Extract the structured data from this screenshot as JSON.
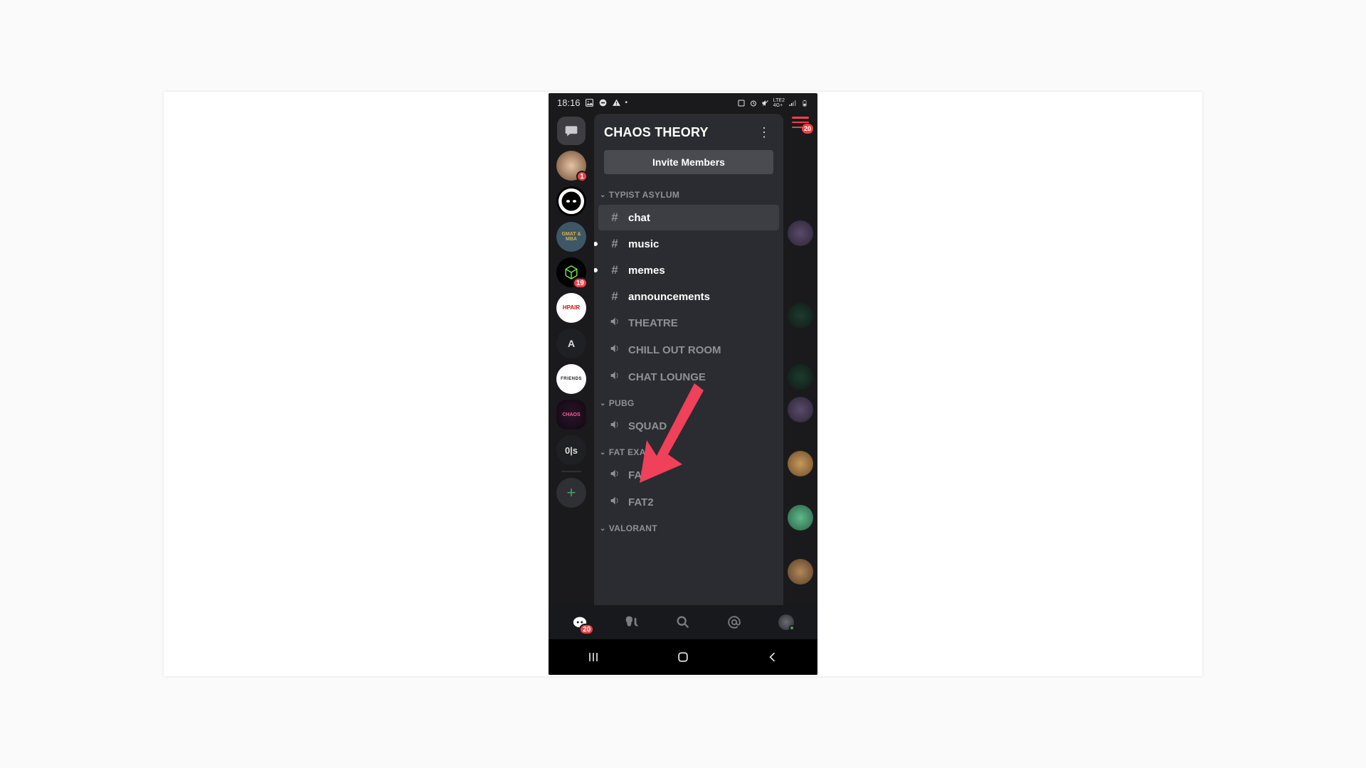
{
  "statusbar": {
    "time": "18:16",
    "net": "4G+",
    "lte": "LTE2"
  },
  "server": {
    "title": "CHAOS THEORY",
    "invite_label": "Invite Members"
  },
  "categories": [
    {
      "name": "TYPIST ASYLUM",
      "channels": [
        {
          "type": "text",
          "label": "chat",
          "active": true
        },
        {
          "type": "text",
          "label": "music",
          "unread": true
        },
        {
          "type": "text",
          "label": "memes",
          "unread": true
        },
        {
          "type": "text",
          "label": "announcements"
        },
        {
          "type": "voice",
          "label": "THEATRE"
        },
        {
          "type": "voice",
          "label": "CHILL OUT ROOM"
        },
        {
          "type": "voice",
          "label": "CHAT LOUNGE"
        }
      ]
    },
    {
      "name": "PUBG",
      "channels": [
        {
          "type": "voice",
          "label": "SQUAD"
        }
      ]
    },
    {
      "name": "FAT EXAM",
      "channels": [
        {
          "type": "voice",
          "label": "FAT"
        },
        {
          "type": "voice",
          "label": "FAT2"
        }
      ]
    },
    {
      "name": "VALORANT",
      "channels": []
    }
  ],
  "guilds": [
    {
      "kind": "dm"
    },
    {
      "kind": "server",
      "label": "",
      "bg": "avatar1",
      "notif": "1"
    },
    {
      "kind": "server",
      "label": "",
      "bg": "ninja",
      "selected_pill": "small"
    },
    {
      "kind": "server",
      "label": "GMAT & MBA",
      "bg": "gmat"
    },
    {
      "kind": "server",
      "label": "",
      "bg": "cube",
      "notif": "19"
    },
    {
      "kind": "server",
      "label": "HPAIR",
      "bg": "white"
    },
    {
      "kind": "server",
      "label": "A",
      "bg": "dark"
    },
    {
      "kind": "server",
      "label": "FRIENDS",
      "bg": "white",
      "tiny": true
    },
    {
      "kind": "server",
      "label": "CHAOS",
      "bg": "chaos",
      "selected": true
    },
    {
      "kind": "server",
      "label": "0|s",
      "bg": "dark"
    },
    {
      "kind": "add"
    }
  ],
  "hamburger_badge": "20",
  "bottom_badge": "20",
  "colors": {
    "accent_red": "#ed4245",
    "arrow": "#f0405a"
  }
}
